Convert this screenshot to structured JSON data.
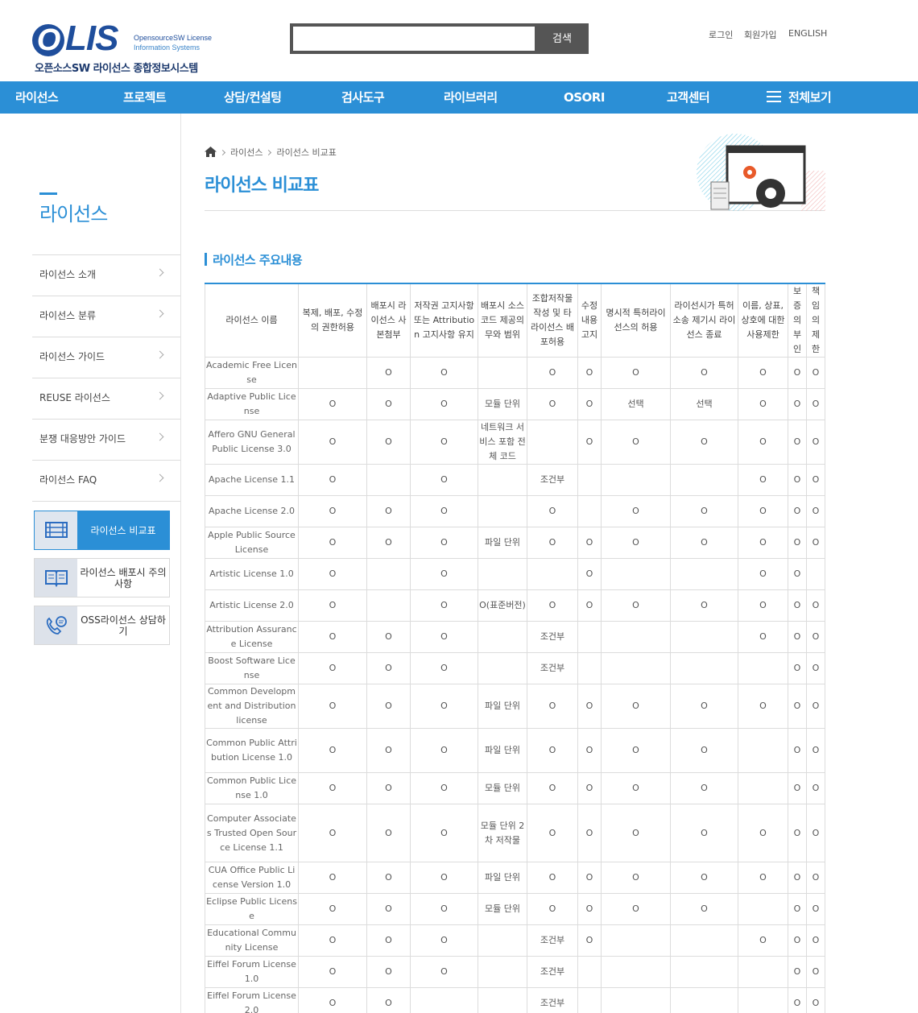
{
  "header": {
    "logo_text": "LIS",
    "logo_o": "O",
    "logo_sub1": "OpensourceSW License",
    "logo_sub2": "Information Systems",
    "logo_kr": "오픈소스SW 라이선스 종합정보시스템",
    "search_placeholder": "",
    "search_button": "검색",
    "util": [
      "로그인",
      "회원가입",
      "ENGLISH"
    ]
  },
  "nav": [
    "라이선스",
    "프로젝트",
    "상담/컨설팅",
    "검사도구",
    "라이브러리",
    "OSORI",
    "고객센터",
    "전체보기"
  ],
  "sidebar": {
    "title": "라이선스",
    "items": [
      "라이선스 소개",
      "라이선스 분류",
      "라이선스 가이드",
      "REUSE 라이선스",
      "분쟁 대응방안 가이드",
      "라이선스 FAQ"
    ],
    "quick": [
      {
        "label": "라이선스 비교표",
        "icon": "table-icon"
      },
      {
        "label": "라이선스 배포시 주의사항",
        "icon": "book-icon"
      },
      {
        "label": "OSS라이선스 상담하기",
        "icon": "phone-chat-icon"
      }
    ]
  },
  "breadcrumb": [
    "라이선스",
    "라이선스 비교표"
  ],
  "page_title": "라이선스 비교표",
  "section_title": "라이선스 주요내용",
  "table": {
    "headers": [
      "라이선스 이름",
      "복제, 배포, 수정의 권한허용",
      "배포시 라이선스 사본첨부",
      "저작권 고지사항 또는 Attribution 고지사항 유지",
      "배포시 소스코드 제공의무와 범위",
      "조합저작물 작성 및 타 라이선스 배포허용",
      "수정 내용 고지",
      "명시적 특허라이선스의 허용",
      "라이선시가 특허소송 제기시 라이선스 종료",
      "이름, 상표, 상호에 대한 사용제한",
      "보증의 부인",
      "책임의 제한"
    ],
    "rows": [
      [
        "Academic Free License",
        "",
        "O",
        "O",
        "",
        "O",
        "O",
        "O",
        "O",
        "O",
        "O",
        "O"
      ],
      [
        "Adaptive Public License",
        "O",
        "O",
        "O",
        "모듈 단위",
        "O",
        "O",
        "선택",
        "선택",
        "O",
        "O",
        "O"
      ],
      [
        "Affero GNU General Public License 3.0",
        "O",
        "O",
        "O",
        "네트워크 서비스 포함 전체 코드",
        "",
        "O",
        "O",
        "O",
        "O",
        "O",
        "O"
      ],
      [
        "Apache License 1.1",
        "O",
        "",
        "O",
        "",
        "조건부",
        "",
        "",
        "",
        "O",
        "O",
        "O"
      ],
      [
        "Apache License 2.0",
        "O",
        "O",
        "O",
        "",
        "O",
        "",
        "O",
        "O",
        "O",
        "O",
        "O"
      ],
      [
        "Apple Public Source License",
        "O",
        "O",
        "O",
        "파일 단위",
        "O",
        "O",
        "O",
        "O",
        "O",
        "O",
        "O"
      ],
      [
        "Artistic License 1.0",
        "O",
        "",
        "O",
        "",
        "",
        "O",
        "",
        "",
        "O",
        "O",
        ""
      ],
      [
        "Artistic License 2.0",
        "O",
        "",
        "O",
        "O(표준버전)",
        "O",
        "O",
        "O",
        "O",
        "O",
        "O",
        "O"
      ],
      [
        "Attribution Assurance License",
        "O",
        "O",
        "O",
        "",
        "조건부",
        "",
        "",
        "",
        "O",
        "O",
        "O"
      ],
      [
        "Boost Software License",
        "O",
        "O",
        "O",
        "",
        "조건부",
        "",
        "",
        "",
        "",
        "O",
        "O"
      ],
      [
        "Common Development and Distribution license",
        "O",
        "O",
        "O",
        "파일 단위",
        "O",
        "O",
        "O",
        "O",
        "O",
        "O",
        "O"
      ],
      [
        "Common Public Attribution License 1.0",
        "O",
        "O",
        "O",
        "파일 단위",
        "O",
        "O",
        "O",
        "O",
        "",
        "O",
        "O"
      ],
      [
        "Common Public License 1.0",
        "O",
        "O",
        "O",
        "모듈 단위",
        "O",
        "O",
        "O",
        "O",
        "",
        "O",
        "O"
      ],
      [
        "Computer Associates Trusted Open Source License 1.1",
        "O",
        "O",
        "O",
        "모듈 단위 2차 저작물",
        "O",
        "O",
        "O",
        "O",
        "O",
        "O",
        "O"
      ],
      [
        "CUA Office Public License Version 1.0",
        "O",
        "O",
        "O",
        "파일 단위",
        "O",
        "O",
        "O",
        "O",
        "O",
        "O",
        "O"
      ],
      [
        "Eclipse Public License",
        "O",
        "O",
        "O",
        "모듈 단위",
        "O",
        "O",
        "O",
        "O",
        "",
        "O",
        "O"
      ],
      [
        "Educational Community License",
        "O",
        "O",
        "O",
        "",
        "조건부",
        "O",
        "",
        "",
        "O",
        "O",
        "O"
      ],
      [
        "Eiffel Forum License 1.0",
        "O",
        "O",
        "O",
        "",
        "조건부",
        "",
        "",
        "",
        "",
        "O",
        "O"
      ],
      [
        "Eiffel Forum License 2.0",
        "O",
        "O",
        "",
        "",
        "조건부",
        "",
        "",
        "",
        "",
        "O",
        "O"
      ]
    ]
  }
}
